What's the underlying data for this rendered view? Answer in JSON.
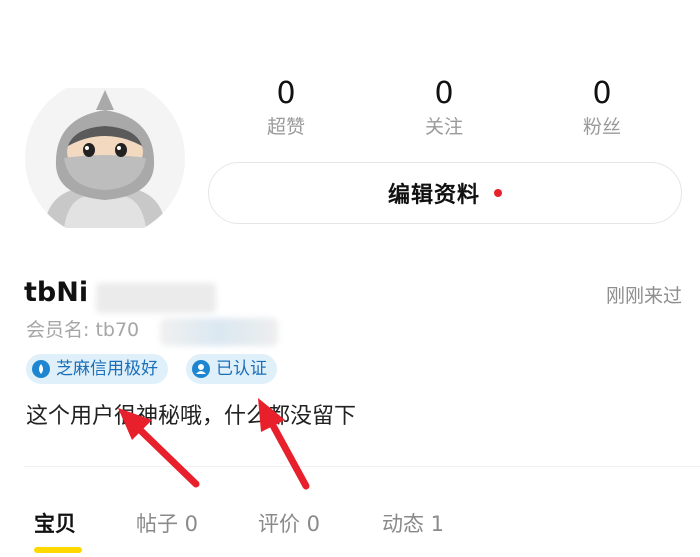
{
  "stats": [
    {
      "value": "0",
      "label": "超赞"
    },
    {
      "value": "0",
      "label": "关注"
    },
    {
      "value": "0",
      "label": "粉丝"
    }
  ],
  "edit_profile": {
    "label": "编辑资料"
  },
  "profile": {
    "nickname": "tbNi",
    "member_id": "会员名: tb70",
    "last_visit": "刚刚来过",
    "bio": "这个用户很神秘哦，什么都没留下"
  },
  "badges": [
    {
      "label": "芝麻信用极好",
      "icon": "sesame-credit-icon"
    },
    {
      "label": "已认证",
      "icon": "verified-icon"
    }
  ],
  "tabs": [
    {
      "label": "宝贝",
      "active": true
    },
    {
      "label": "帖子 0",
      "active": false
    },
    {
      "label": "评价 0",
      "active": false
    },
    {
      "label": "动态 1",
      "active": false
    }
  ],
  "colors": {
    "badge_bg": "#dff0fb",
    "badge_text": "#1b6fb8",
    "accent_red": "#e8202b",
    "tab_underline": "#ffd800",
    "annotation_arrow": "#e8202b"
  }
}
